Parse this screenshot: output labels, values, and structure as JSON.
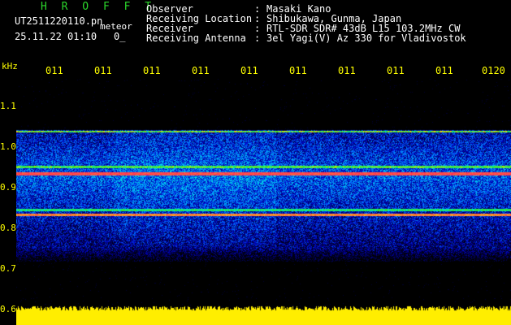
{
  "app": {
    "title": "H R O F F T",
    "file_name": "UT2511220110.pn",
    "meteor_tag": "meteor",
    "date_time": "25.11.22 01:10",
    "counter": "0_"
  },
  "header": [
    {
      "label": "Observer",
      "value": "Masaki Kano"
    },
    {
      "label": "Receiving Location",
      "value": "Shibukawa, Gunma, Japan"
    },
    {
      "label": "Receiver",
      "value": "RTL-SDR SDR# 43dB L15 103.2MHz CW"
    },
    {
      "label": "Receiving Antenna",
      "value": "3el Yagi(V) Az 330 for Vladivostok"
    }
  ],
  "time_axis": [
    "011",
    "011",
    "011",
    "011",
    "011",
    "011",
    "011",
    "011",
    "011",
    "0120"
  ],
  "freq_axis": {
    "unit": "kHz",
    "labels": [
      "1.1",
      "1.0",
      "0.9",
      "0.8",
      "0.7",
      "0.6"
    ]
  },
  "colors": {
    "title": "#2bd62b",
    "text": "#ffffff",
    "axis": "#ffff00",
    "background": "#000000",
    "carrier": "#ff3a7a"
  }
}
